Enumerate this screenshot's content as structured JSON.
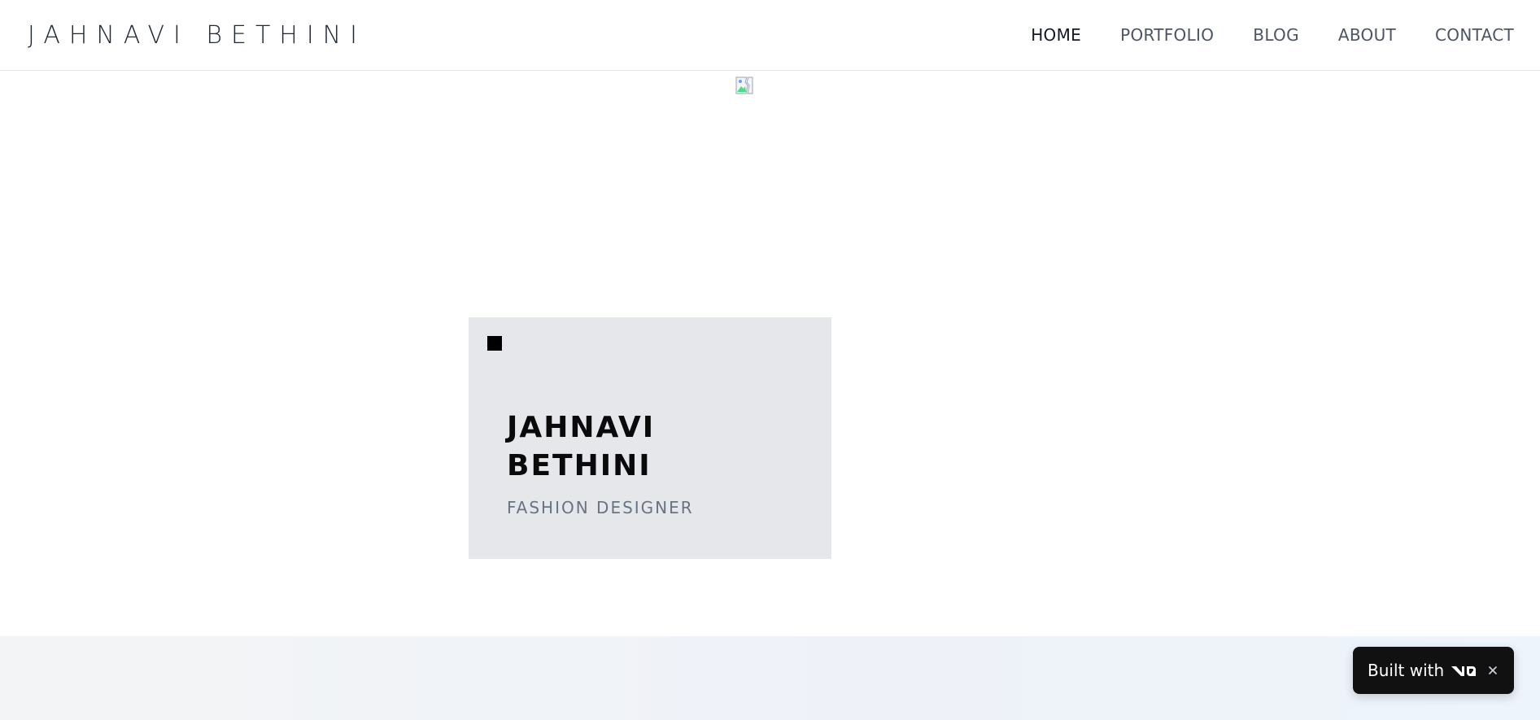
{
  "header": {
    "logo": "JAHNAVI BETHINI",
    "nav": [
      {
        "label": "HOME",
        "active": true
      },
      {
        "label": "PORTFOLIO",
        "active": false
      },
      {
        "label": "BLOG",
        "active": false
      },
      {
        "label": "ABOUT",
        "active": false
      },
      {
        "label": "CONTACT",
        "active": false
      }
    ]
  },
  "hero": {
    "image_icon": "broken-image-icon",
    "name_line1": "JAHNAVI",
    "name_line2": "BETHINI",
    "subtitle": "FASHION DESIGNER"
  },
  "toast": {
    "label": "Built with",
    "brand_icon": "v0-logo-icon",
    "close_icon": "close-icon"
  },
  "colors": {
    "card_bg": "#e5e7eb",
    "toast_bg": "#111111",
    "nav_active": "#111827",
    "nav_inactive": "#4b5563",
    "subtitle": "#6b7280"
  }
}
